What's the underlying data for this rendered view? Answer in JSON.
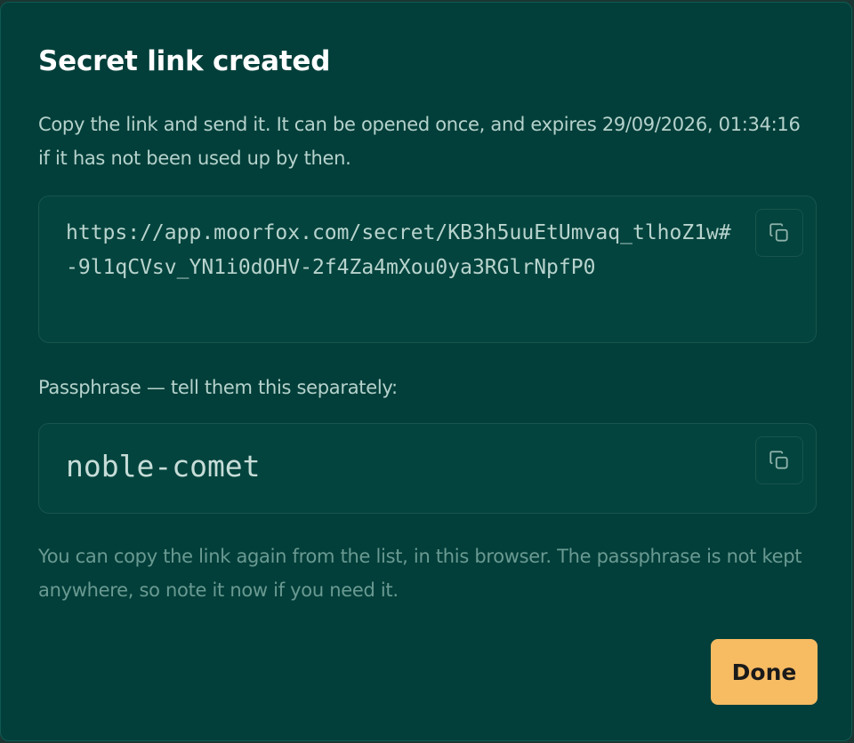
{
  "dialog": {
    "title": "Secret link created",
    "description": "Copy the link and send it. It can be opened once, and expires 29/09/2026, 01:34:16 if it has not been used up by then.",
    "link": {
      "url": "https://app.moorfox.com/secret/KB3h5uuEtUmvaq_tlhoZ1w#-9l1qCVsv_YN1i0dOHV-2f4Za4mXou0ya3RGlrNpfP0",
      "copy_icon": "copy-icon"
    },
    "passphrase": {
      "label": "Passphrase — tell them this separately:",
      "value": "noble-comet",
      "copy_icon": "copy-icon"
    },
    "note": "You can copy the link again from the list, in this browser. The passphrase is not kept anywhere, so note it now if you need it.",
    "done_label": "Done"
  },
  "colors": {
    "dialog_background": "#023f3a",
    "accent_button": "#f7bb62",
    "text_primary": "#ffffff",
    "text_secondary": "#b6d2cc",
    "text_muted": "#6a9a92"
  }
}
